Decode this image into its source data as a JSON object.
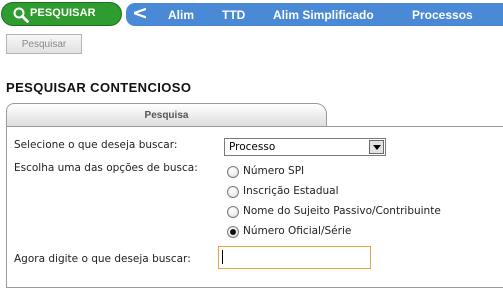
{
  "nav": {
    "pesquisar_label": "PESQUISAR",
    "back_symbol": "<",
    "items": [
      "Alim",
      "TTD",
      "Alim Simplificado",
      "Processos"
    ],
    "colors": {
      "pill": "#2e9c2e",
      "bar": "#4a89d6"
    }
  },
  "toolbar": {
    "pesquisar_button": "Pesquisar"
  },
  "page": {
    "title": "PESQUISAR CONTENCIOSO"
  },
  "tab": {
    "label": "Pesquisa"
  },
  "form": {
    "select_label": "Selecione o que deseja buscar:",
    "select_value": "Processo",
    "options_label": "Escolha uma das opções de busca:",
    "radios": [
      {
        "label": "Número SPI",
        "checked": false
      },
      {
        "label": "Inscrição Estadual",
        "checked": false
      },
      {
        "label": "Nome do Sujeito Passivo/Contribuinte",
        "checked": false
      },
      {
        "label": "Número Oficial/Série",
        "checked": true
      }
    ],
    "input_label": "Agora digite o que deseja buscar:",
    "input_value": ""
  }
}
